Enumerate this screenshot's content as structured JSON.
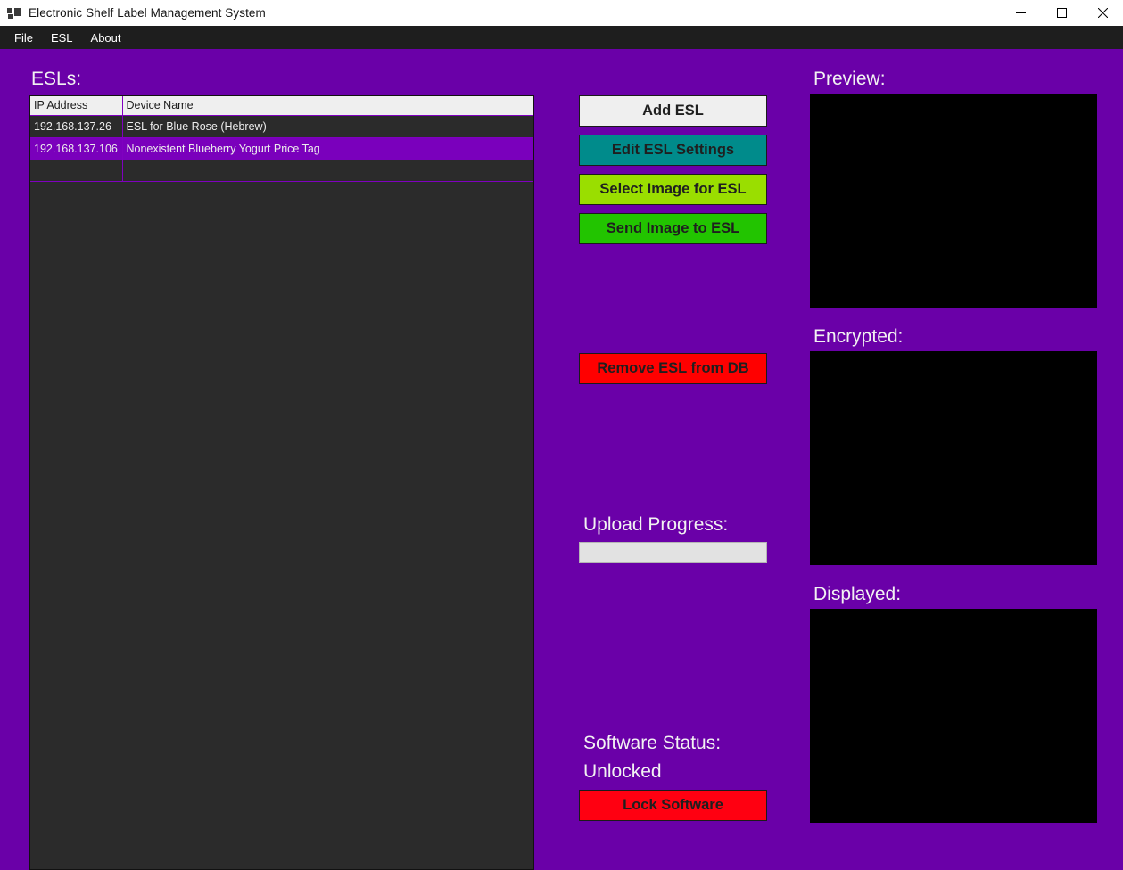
{
  "window": {
    "title": "Electronic Shelf Label Management System",
    "icon": "app-window-icon",
    "controls": {
      "minimize": "minimize-icon",
      "maximize": "maximize-icon",
      "close": "close-icon"
    }
  },
  "menubar": {
    "items": [
      {
        "label": "File"
      },
      {
        "label": "ESL"
      },
      {
        "label": "About"
      }
    ]
  },
  "left": {
    "heading": "ESLs:",
    "table": {
      "columns": [
        "IP Address",
        "Device Name"
      ],
      "rows": [
        {
          "ip": "192.168.137.26",
          "device_name": "ESL for Blue Rose (Hebrew)",
          "selected": false
        },
        {
          "ip": "192.168.137.106",
          "device_name": "Nonexistent Blueberry Yogurt Price Tag",
          "selected": true
        },
        {
          "ip": "",
          "device_name": "",
          "selected": false
        }
      ]
    }
  },
  "middle": {
    "buttons": {
      "add_esl": "Add ESL",
      "edit_settings": "Edit ESL Settings",
      "select_image": "Select Image for ESL",
      "send_image": "Send Image to ESL",
      "remove_esl": "Remove ESL from DB",
      "lock_software": "Lock Software"
    },
    "upload_progress": {
      "label": "Upload Progress:",
      "percent": 0
    },
    "software_status": {
      "label": "Software Status:",
      "value": "Unlocked"
    }
  },
  "right": {
    "panels": [
      {
        "label": "Preview:",
        "content": ""
      },
      {
        "label": "Encrypted:",
        "content": ""
      },
      {
        "label": "Displayed:",
        "content": ""
      }
    ]
  },
  "colors": {
    "background_purple": "#6A00A8",
    "titlebar": "#FFFFFF",
    "menubar": "#1E1E1E",
    "list_background": "#2B2B2B",
    "list_selection": "#7A00BC",
    "add_esl": "#EFEFEF",
    "edit_settings": "#008B8B",
    "select_image": "#9ADE00",
    "send_image": "#22C400",
    "remove_esl": "#FF0000",
    "lock_software": "#FF0011",
    "panel_black": "#000000",
    "progress_track": "#E2E2E2"
  }
}
